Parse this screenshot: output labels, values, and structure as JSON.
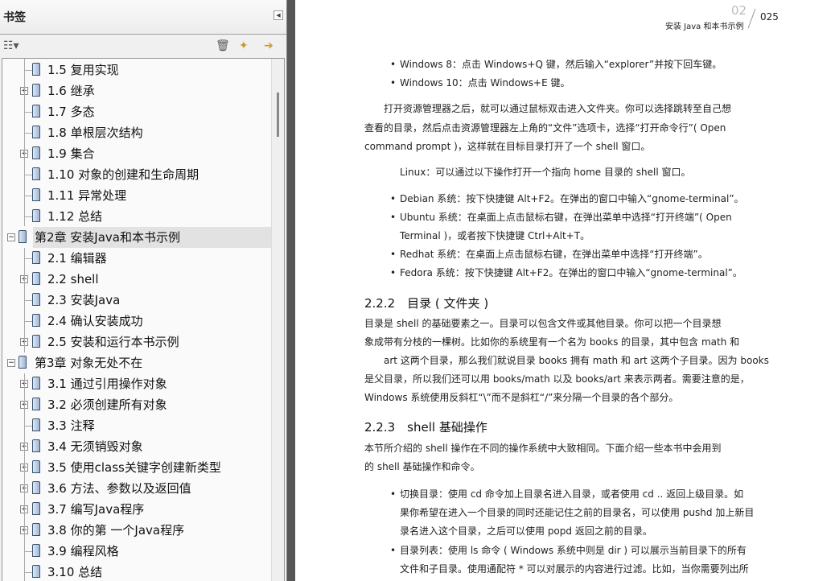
{
  "sidebar": {
    "title": "书签",
    "tools": [
      "options-menu",
      "delete",
      "new-bookmark",
      "expand-bookmark"
    ],
    "items": [
      {
        "label": "1.5 复用实现",
        "level": 1,
        "toggle": ""
      },
      {
        "label": "1.6 继承",
        "level": 1,
        "toggle": "+"
      },
      {
        "label": "1.7 多态",
        "level": 1,
        "toggle": ""
      },
      {
        "label": "1.8 单根层次结构",
        "level": 1,
        "toggle": ""
      },
      {
        "label": "1.9 集合",
        "level": 1,
        "toggle": "+"
      },
      {
        "label": "1.10 对象的创建和生命周期",
        "level": 1,
        "toggle": ""
      },
      {
        "label": "1.11 异常处理",
        "level": 1,
        "toggle": ""
      },
      {
        "label": "1.12 总结",
        "level": 1,
        "toggle": ""
      },
      {
        "label": "第2章 安装Java和本书示例",
        "level": 0,
        "toggle": "−",
        "selected": true
      },
      {
        "label": "2.1 编辑器",
        "level": 1,
        "toggle": ""
      },
      {
        "label": "2.2 shell",
        "level": 1,
        "toggle": "+"
      },
      {
        "label": "2.3 安装Java",
        "level": 1,
        "toggle": ""
      },
      {
        "label": "2.4 确认安装成功",
        "level": 1,
        "toggle": ""
      },
      {
        "label": "2.5 安装和运行本书示例",
        "level": 1,
        "toggle": "+"
      },
      {
        "label": "第3章 对象无处不在",
        "level": 0,
        "toggle": "−"
      },
      {
        "label": "3.1 通过引用操作对象",
        "level": 1,
        "toggle": "+"
      },
      {
        "label": "3.2 必须创建所有对象",
        "level": 1,
        "toggle": "+"
      },
      {
        "label": "3.3 注释",
        "level": 1,
        "toggle": ""
      },
      {
        "label": "3.4 无须销毁对象",
        "level": 1,
        "toggle": "+"
      },
      {
        "label": "3.5 使用class关键字创建新类型",
        "level": 1,
        "toggle": "+"
      },
      {
        "label": "3.6 方法、参数以及返回值",
        "level": 1,
        "toggle": "+"
      },
      {
        "label": "3.7 编写Java程序",
        "level": 1,
        "toggle": "+"
      },
      {
        "label": "3.8 你的第 一个Java程序",
        "level": 1,
        "toggle": "+"
      },
      {
        "label": "3.9 编程风格",
        "level": 1,
        "toggle": ""
      },
      {
        "label": "3.10 总结",
        "level": 1,
        "toggle": ""
      }
    ]
  },
  "page": {
    "chapter_no": "02",
    "chapter_title": "安装 Java 和本书示例",
    "page_no": "025",
    "bullets1": [
      "Windows 8：点击 Windows+Q 键，然后输入“explorer”并按下回车键。",
      "Windows 10：点击 Windows+E 键。"
    ],
    "para1": [
      "打开资源管理器之后，就可以通过鼠标双击进入文件夹。你可以选择跳转至自己想",
      "查看的目录，然后点击资源管理器左上角的“文件”选项卡，选择“打开命令行”( Open",
      "command prompt )，这样就在目标目录打开了一个 shell 窗口。"
    ],
    "linux": "Linux：可以通过以下操作打开一个指向 home 目录的 shell 窗口。",
    "bullets2": [
      "Debian 系统：按下快捷键 Alt+F2。在弹出的窗口中输入“gnome-terminal”。",
      "Ubuntu 系统：在桌面上点击鼠标右键，在弹出菜单中选择“打开终端”( Open",
      "Terminal )，或者按下快捷键 Ctrl+Alt+T。",
      "Redhat 系统：在桌面上点击鼠标右键，在弹出菜单中选择“打开终端”。",
      "Fedora 系统：按下快捷键 Alt+F2。在弹出的窗口中输入“gnome-terminal”。"
    ],
    "h222": "2.2.2　目录 ( 文件夹 )",
    "para2": [
      "目录是 shell 的基础要素之一。目录可以包含文件或其他目录。你可以把一个目录想",
      "象成带有分枝的一棵树。比如你的系统里有一个名为 books 的目录，其中包含 math 和",
      "art 这两个目录，那么我们就说目录 books 拥有 math 和 art 这两个子目录。因为 books",
      "是父目录，所以我们还可以用 books/math 以及 books/art 来表示两者。需要注意的是，",
      "Windows 系统使用反斜杠“\\”而不是斜杠“/”来分隔一个目录的各个部分。"
    ],
    "h223": "2.2.3　shell 基础操作",
    "para3": [
      "本节所介绍的 shell 操作在不同的操作系统中大致相同。下面介绍一些本书中会用到",
      "的 shell 基础操作和命令。"
    ],
    "bullets3": [
      "切换目录：使用 cd 命令加上目录名进入目录，或者使用 cd  .. 返回上级目录。如",
      "果你希望在进入一个目录的同时还能记住之前的目录名，可以使用 pushd 加上新目",
      "录名进入这个目录，之后可以使用 popd 返回之前的目录。",
      "目录列表：使用 ls 命令 ( Windows 系统中则是 dir ) 可以展示当前目录下的所有",
      "文件和子目录。使用通配符 * 可以对展示的内容进行过滤。比如，当你需要列出所"
    ]
  }
}
